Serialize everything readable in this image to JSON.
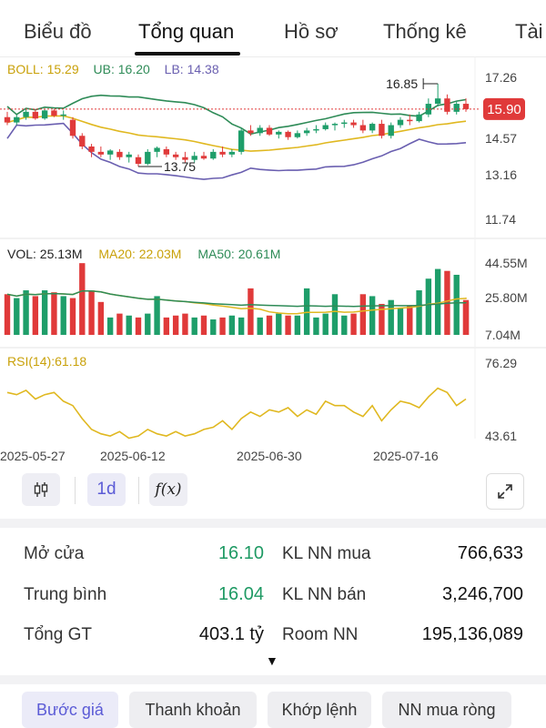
{
  "tabs": [
    {
      "label": "Biểu đồ"
    },
    {
      "label": "Tổng quan"
    },
    {
      "label": "Hồ sơ"
    },
    {
      "label": "Thống kê"
    },
    {
      "label": "Tài"
    }
  ],
  "colors": {
    "up": "#1e9e6a",
    "down": "#e03a3a",
    "boll_mid": "#e0b820",
    "boll_ub": "#2e8b57",
    "boll_lb": "#6a5fb0",
    "ma20": "#e0b820",
    "ma50": "#2e8b57",
    "rsi": "#e0b820",
    "price_tag": "#e03a3a",
    "accent": "#5b5bd6"
  },
  "chart_data": [
    {
      "type": "candlestick",
      "legend": {
        "boll": "BOLL: 15.29",
        "ub": "UB: 16.20",
        "lb": "LB: 14.38"
      },
      "y_ticks": [
        "17.26",
        "14.57",
        "13.16",
        "11.74"
      ],
      "ylim": [
        11.74,
        17.26
      ],
      "current_price": "15.90",
      "high_annotation": "16.85",
      "low_annotation": "13.75",
      "candles": [
        {
          "o": 15.6,
          "h": 15.8,
          "l": 15.3,
          "c": 15.4
        },
        {
          "o": 15.4,
          "h": 15.7,
          "l": 15.3,
          "c": 15.6
        },
        {
          "o": 15.6,
          "h": 15.9,
          "l": 15.5,
          "c": 15.8
        },
        {
          "o": 15.8,
          "h": 15.9,
          "l": 15.5,
          "c": 15.55
        },
        {
          "o": 15.55,
          "h": 15.9,
          "l": 15.5,
          "c": 15.85
        },
        {
          "o": 15.85,
          "h": 15.9,
          "l": 15.6,
          "c": 15.65
        },
        {
          "o": 15.65,
          "h": 15.85,
          "l": 15.5,
          "c": 15.7
        },
        {
          "o": 15.5,
          "h": 15.6,
          "l": 14.8,
          "c": 14.9
        },
        {
          "o": 14.9,
          "h": 15.0,
          "l": 14.4,
          "c": 14.5
        },
        {
          "o": 14.5,
          "h": 14.6,
          "l": 14.1,
          "c": 14.3
        },
        {
          "o": 14.3,
          "h": 14.5,
          "l": 14.1,
          "c": 14.2
        },
        {
          "o": 14.2,
          "h": 14.4,
          "l": 14.0,
          "c": 14.35
        },
        {
          "o": 14.3,
          "h": 14.4,
          "l": 14.0,
          "c": 14.1
        },
        {
          "o": 14.1,
          "h": 14.3,
          "l": 13.9,
          "c": 14.2
        },
        {
          "o": 14.1,
          "h": 14.2,
          "l": 13.75,
          "c": 13.85
        },
        {
          "o": 13.85,
          "h": 14.4,
          "l": 13.8,
          "c": 14.3
        },
        {
          "o": 14.3,
          "h": 14.5,
          "l": 14.1,
          "c": 14.45
        },
        {
          "o": 14.4,
          "h": 14.5,
          "l": 14.1,
          "c": 14.2
        },
        {
          "o": 14.2,
          "h": 14.3,
          "l": 14.0,
          "c": 14.1
        },
        {
          "o": 14.1,
          "h": 14.3,
          "l": 13.9,
          "c": 14.0
        },
        {
          "o": 14.0,
          "h": 14.3,
          "l": 13.9,
          "c": 14.15
        },
        {
          "o": 14.15,
          "h": 14.3,
          "l": 14.0,
          "c": 14.05
        },
        {
          "o": 14.05,
          "h": 14.4,
          "l": 14.0,
          "c": 14.3
        },
        {
          "o": 14.3,
          "h": 14.5,
          "l": 14.1,
          "c": 14.2
        },
        {
          "o": 14.2,
          "h": 14.4,
          "l": 14.1,
          "c": 14.3
        },
        {
          "o": 14.3,
          "h": 15.2,
          "l": 14.2,
          "c": 15.1
        },
        {
          "o": 15.1,
          "h": 15.3,
          "l": 14.9,
          "c": 15.0
        },
        {
          "o": 15.0,
          "h": 15.3,
          "l": 14.9,
          "c": 15.2
        },
        {
          "o": 15.2,
          "h": 15.3,
          "l": 14.9,
          "c": 14.95
        },
        {
          "o": 14.95,
          "h": 15.1,
          "l": 14.8,
          "c": 15.05
        },
        {
          "o": 15.05,
          "h": 15.1,
          "l": 14.75,
          "c": 14.85
        },
        {
          "o": 14.85,
          "h": 15.1,
          "l": 14.8,
          "c": 15.0
        },
        {
          "o": 15.0,
          "h": 15.2,
          "l": 14.9,
          "c": 15.1
        },
        {
          "o": 15.1,
          "h": 15.3,
          "l": 15.0,
          "c": 15.15
        },
        {
          "o": 15.15,
          "h": 15.4,
          "l": 15.1,
          "c": 15.3
        },
        {
          "o": 15.3,
          "h": 15.4,
          "l": 15.1,
          "c": 15.35
        },
        {
          "o": 15.35,
          "h": 15.5,
          "l": 15.2,
          "c": 15.4
        },
        {
          "o": 15.4,
          "h": 15.5,
          "l": 15.2,
          "c": 15.3
        },
        {
          "o": 15.3,
          "h": 15.5,
          "l": 15.0,
          "c": 15.1
        },
        {
          "o": 15.1,
          "h": 15.4,
          "l": 15.0,
          "c": 15.35
        },
        {
          "o": 15.35,
          "h": 15.5,
          "l": 14.8,
          "c": 14.9
        },
        {
          "o": 14.9,
          "h": 15.4,
          "l": 14.8,
          "c": 15.3
        },
        {
          "o": 15.3,
          "h": 15.6,
          "l": 15.2,
          "c": 15.5
        },
        {
          "o": 15.5,
          "h": 15.7,
          "l": 15.3,
          "c": 15.45
        },
        {
          "o": 15.45,
          "h": 15.8,
          "l": 15.4,
          "c": 15.7
        },
        {
          "o": 15.7,
          "h": 16.3,
          "l": 15.6,
          "c": 16.1
        },
        {
          "o": 16.1,
          "h": 16.85,
          "l": 16.0,
          "c": 16.3
        },
        {
          "o": 16.3,
          "h": 16.45,
          "l": 15.7,
          "c": 15.8
        },
        {
          "o": 15.8,
          "h": 16.2,
          "l": 15.7,
          "c": 16.1
        },
        {
          "o": 16.1,
          "h": 16.3,
          "l": 15.8,
          "c": 15.9
        }
      ]
    },
    {
      "type": "bar",
      "legend": {
        "vol": "VOL: 25.13M",
        "ma20": "MA20: 22.03M",
        "ma50": "MA50: 20.61M"
      },
      "y_ticks": [
        "44.55M",
        "25.80M",
        "7.04M"
      ],
      "ylim": [
        7.04,
        44.55
      ],
      "unit": "M",
      "values": [
        28,
        26,
        30,
        27,
        30,
        29,
        27,
        26,
        44,
        30,
        24,
        16,
        18,
        17,
        16,
        18,
        27,
        16,
        17,
        18,
        16,
        17,
        15,
        16,
        17,
        16,
        31,
        16,
        17,
        18,
        17,
        17,
        31,
        16,
        18,
        28,
        17,
        18,
        28,
        27,
        23,
        25,
        21,
        22,
        30,
        36,
        41,
        40,
        38,
        24,
        25
      ]
    },
    {
      "type": "line",
      "legend": {
        "rsi": "RSI(14):61.18"
      },
      "y_ticks": [
        "76.29",
        "43.61"
      ],
      "ylim": [
        43.61,
        76.29
      ],
      "values": [
        64,
        63,
        65,
        61,
        63,
        64,
        60,
        58,
        52,
        47,
        45,
        44,
        46,
        43,
        44,
        47,
        45,
        44,
        46,
        44,
        45,
        47,
        48,
        51,
        47,
        52,
        55,
        53,
        56,
        55,
        57,
        53,
        56,
        54,
        60,
        58,
        58,
        55,
        53,
        58,
        51,
        56,
        60,
        59,
        57,
        62,
        66,
        64,
        58,
        61,
        61
      ],
      "x_labels": [
        "2025-05-27",
        "2025-06-12",
        "2025-06-30",
        "2025-07-16"
      ]
    }
  ],
  "toolbar": {
    "interval": "1d",
    "fx": "f(x)"
  },
  "stats": {
    "open_label": "Mở cửa",
    "open_value": "16.10",
    "avg_label": "Trung bình",
    "avg_value": "16.04",
    "total_label": "Tổng GT",
    "total_value": "403.1 tỷ",
    "foreign_buy_label": "KL NN mua",
    "foreign_buy_value": "766,633",
    "foreign_sell_label": "KL NN bán",
    "foreign_sell_value": "3,246,700",
    "room_label": "Room NN",
    "room_value": "195,136,089"
  },
  "chips": [
    {
      "label": "Bước giá"
    },
    {
      "label": "Thanh khoản"
    },
    {
      "label": "Khớp lệnh"
    },
    {
      "label": "NN mua ròng"
    }
  ]
}
